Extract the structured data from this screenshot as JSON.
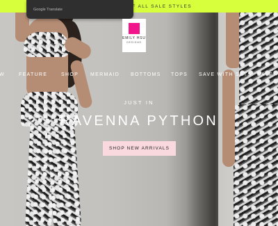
{
  "promo_bar": {
    "text": "0% OFF ALL SALE STYLES"
  },
  "translate_popup": {
    "label": "Google Translate"
  },
  "logo": {
    "name": "EMILY HSU",
    "sub": "DESIGNS",
    "accent": "#f2168d"
  },
  "nav": {
    "items": [
      "W",
      "FEATURE",
      "SHOP",
      "MERMAID",
      "BOTTOMS",
      "TOPS",
      "SAVE WITH SETS",
      "SALE"
    ]
  },
  "hero": {
    "kicker": "JUST IN",
    "headline": "RAVENNA PYTHON",
    "cta": "SHOP NEW ARRIVALS"
  },
  "colors": {
    "promo_bg": "#d7ff3c",
    "cta_bg": "#f9d9de"
  }
}
